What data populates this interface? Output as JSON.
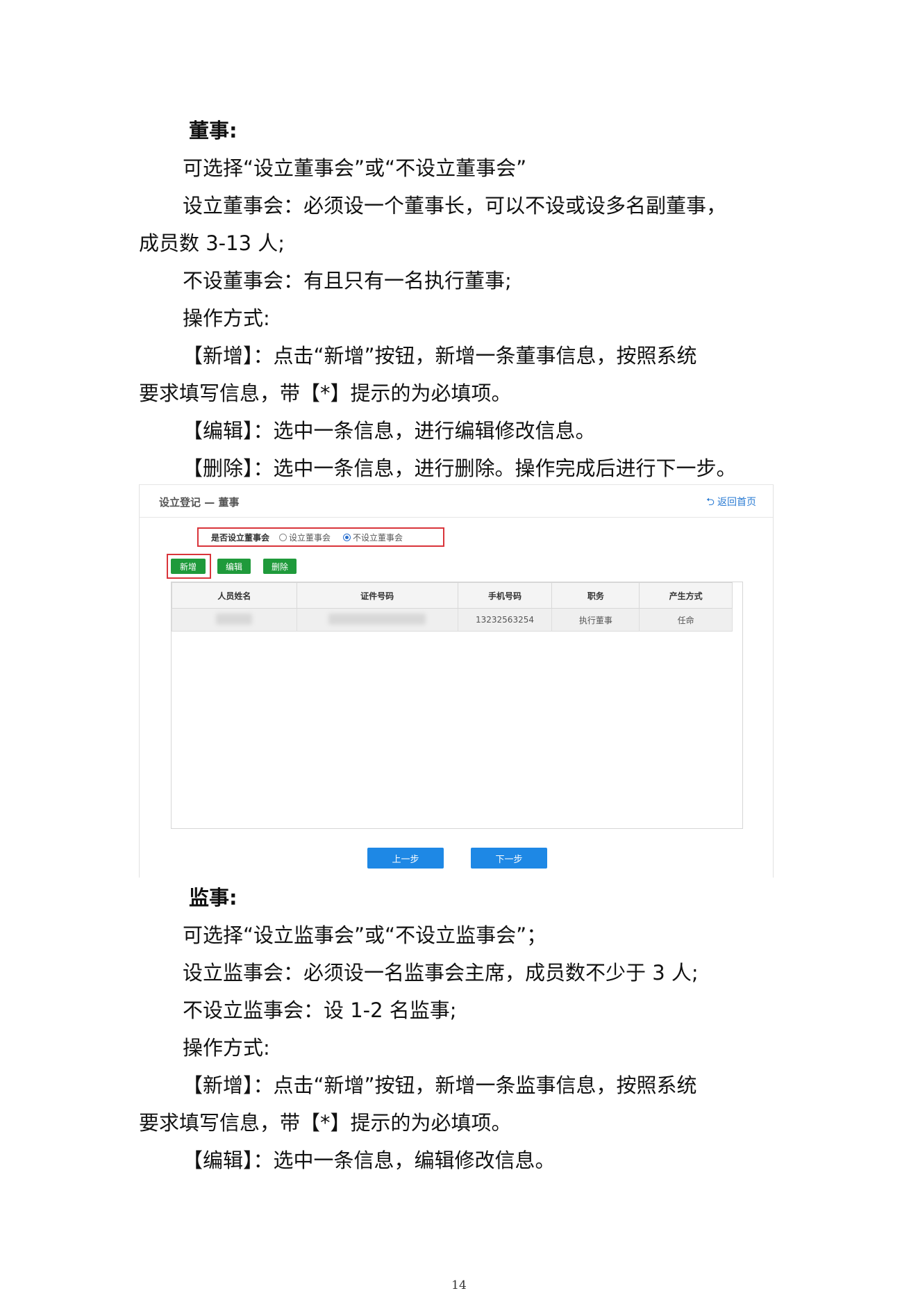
{
  "section1": {
    "heading": "董事:",
    "lines": [
      "可选择“设立董事会”或“不设立董事会”",
      "设立董事会：必须设一个董事长，可以不设或设多名副董事，",
      "成员数 3-13 人;",
      "不设董事会：有且只有一名执行董事;",
      "操作方式:",
      "【新增】：点击“新增”按钮，新增一条董事信息，按照系统",
      "要求填写信息，带【*】提示的为必填项。",
      "【编辑】：选中一条信息，进行编辑修改信息。",
      "【删除】：选中一条信息，进行删除。操作完成后进行下一步。"
    ]
  },
  "screenshot": {
    "breadcrumb": "设立登记 — 董事",
    "back_label": "返回首页",
    "question": "是否设立董事会",
    "option_yes": "设立董事会",
    "option_no": "不设立董事会",
    "selected": "不设立董事会",
    "buttons": {
      "add": "新增",
      "edit": "编辑",
      "delete": "删除"
    },
    "columns": [
      "人员姓名",
      "证件号码",
      "手机号码",
      "职务",
      "产生方式"
    ],
    "rows": [
      {
        "name": "",
        "id": "",
        "phone": "13232563254",
        "position": "执行董事",
        "method": "任命"
      }
    ],
    "prev_label": "上一步",
    "next_label": "下一步"
  },
  "section2": {
    "heading": "监事:",
    "lines": [
      "可选择“设立监事会”或“不设立监事会”；",
      "设立监事会：必须设一名监事会主席，成员数不少于 3 人;",
      "不设立监事会：设 1-2 名监事;",
      "操作方式:",
      "【新增】：点击“新增”按钮，新增一条监事信息，按照系统",
      "要求填写信息，带【*】提示的为必填项。",
      "【编辑】：选中一条信息，编辑修改信息。"
    ]
  },
  "page_number": "14"
}
